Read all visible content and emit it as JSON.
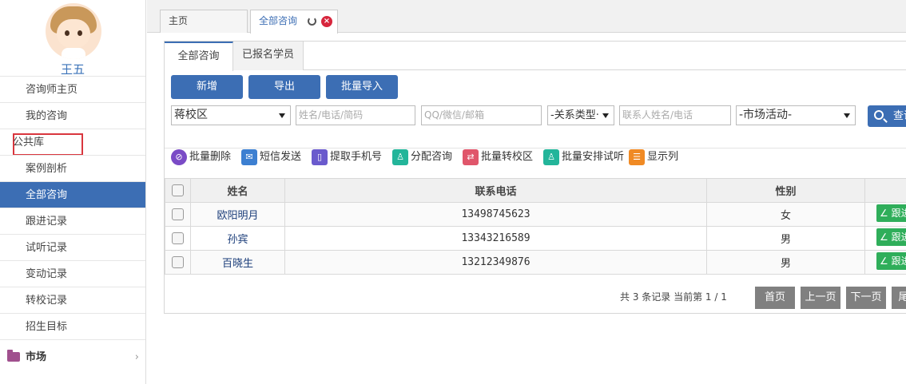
{
  "user": {
    "name": "王五"
  },
  "sidebar": {
    "items": [
      {
        "label": "咨询师主页"
      },
      {
        "label": "我的咨询"
      },
      {
        "label": "公共库"
      },
      {
        "label": "案例剖析"
      },
      {
        "label": "全部咨询"
      },
      {
        "label": "跟进记录"
      },
      {
        "label": "试听记录"
      },
      {
        "label": "变动记录"
      },
      {
        "label": "转校记录"
      },
      {
        "label": "招生目标"
      }
    ],
    "section": {
      "label": "市场",
      "arrow": "›"
    }
  },
  "top_tabs": [
    {
      "label": "主页"
    },
    {
      "label": "全部咨询"
    }
  ],
  "sub_tabs": [
    {
      "label": "全部咨询"
    },
    {
      "label": "已报名学员"
    }
  ],
  "buttons": {
    "add": "新增",
    "export": "导出",
    "bulk_import": "批量导入"
  },
  "filters": {
    "campus": "蒋校区",
    "name_placeholder": "姓名/电话/简码",
    "contact_placeholder": "QQ/微信/邮箱",
    "relation_type": "-关系类型·",
    "contact_person_placeholder": "联系人姓名/电话",
    "market_activity": "-市场活动-",
    "query": "查询"
  },
  "actions": [
    {
      "label": "批量删除"
    },
    {
      "label": "短信发送"
    },
    {
      "label": "提取手机号"
    },
    {
      "label": "分配咨询"
    },
    {
      "label": "批量转校区"
    },
    {
      "label": "批量安排试听"
    },
    {
      "label": "显示列"
    }
  ],
  "table": {
    "headers": {
      "name": "姓名",
      "phone": "联系电话",
      "gender": "性别"
    },
    "follow_label": "∠ 跟进",
    "rows": [
      {
        "name": "欧阳明月",
        "phone": "13498745623",
        "gender": "女"
      },
      {
        "name": "孙宾",
        "phone": "13343216589",
        "gender": "男"
      },
      {
        "name": "百晓生",
        "phone": "13212349876",
        "gender": "男"
      }
    ]
  },
  "pager": {
    "info": "共 3 条记录 当前第 1 / 1",
    "first": "首页",
    "prev": "上一页",
    "next": "下一页",
    "last": "尾"
  },
  "colors": {
    "accent": "#3c6eb4",
    "follow": "#2fae5a",
    "highlight": "#d9363e"
  }
}
